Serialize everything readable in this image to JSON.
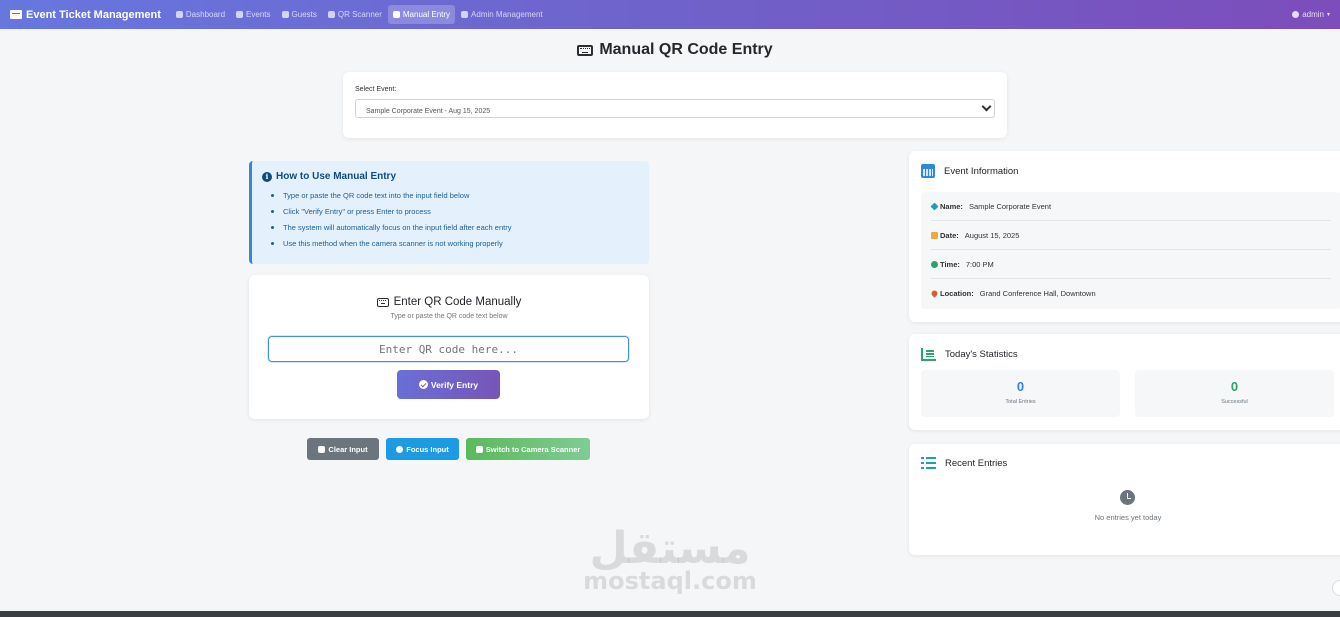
{
  "navbar": {
    "brand": "Event Ticket Management",
    "items": [
      {
        "label": "Dashboard",
        "icon": "dashboard-icon",
        "active": false
      },
      {
        "label": "Events",
        "icon": "calendar-icon",
        "active": false
      },
      {
        "label": "Guests",
        "icon": "users-icon",
        "active": false
      },
      {
        "label": "QR Scanner",
        "icon": "camera-icon",
        "active": false
      },
      {
        "label": "Manual Entry",
        "icon": "keyboard-icon",
        "active": true
      },
      {
        "label": "Admin Management",
        "icon": "user-cog-icon",
        "active": false
      }
    ],
    "user": "admin"
  },
  "page": {
    "title": "Manual QR Code Entry"
  },
  "event_select": {
    "label": "Select Event:",
    "selected": "Sample Corporate Event - Aug 15, 2025"
  },
  "help": {
    "title": "How to Use Manual Entry",
    "items": [
      "Type or paste the QR code text into the input field below",
      "Click \"Verify Entry\" or press Enter to process",
      "The system will automatically focus on the input field after each entry",
      "Use this method when the camera scanner is not working properly"
    ]
  },
  "entry": {
    "title": "Enter QR Code Manually",
    "subtitle": "Type or paste the QR code text below",
    "placeholder": "Enter QR code here...",
    "value": "",
    "verify_label": "Verify Entry"
  },
  "actions": {
    "clear": "Clear Input",
    "focus": "Focus Input",
    "camera": "Switch to Camera Scanner"
  },
  "event_info": {
    "title": "Event Information",
    "rows": [
      {
        "label": "Name:",
        "value": "Sample Corporate Event"
      },
      {
        "label": "Date:",
        "value": "August 15, 2025"
      },
      {
        "label": "Time:",
        "value": "7:00 PM"
      },
      {
        "label": "Location:",
        "value": "Grand Conference Hall, Downtown"
      }
    ]
  },
  "stats": {
    "title": "Today's Statistics",
    "total_value": "0",
    "total_label": "Total Entries",
    "success_value": "0",
    "success_label": "Successful"
  },
  "recent": {
    "title": "Recent Entries",
    "empty": "No entries yet today"
  },
  "watermark": {
    "arabic": "مستقل",
    "latin": "mostaql.com"
  },
  "colors": {
    "nav_gradient_start": "#6777df",
    "nav_gradient_end": "#7c4dbb",
    "primary": "#2d86e0",
    "success": "#2ca36a",
    "info_bg": "#e4f1fc"
  }
}
